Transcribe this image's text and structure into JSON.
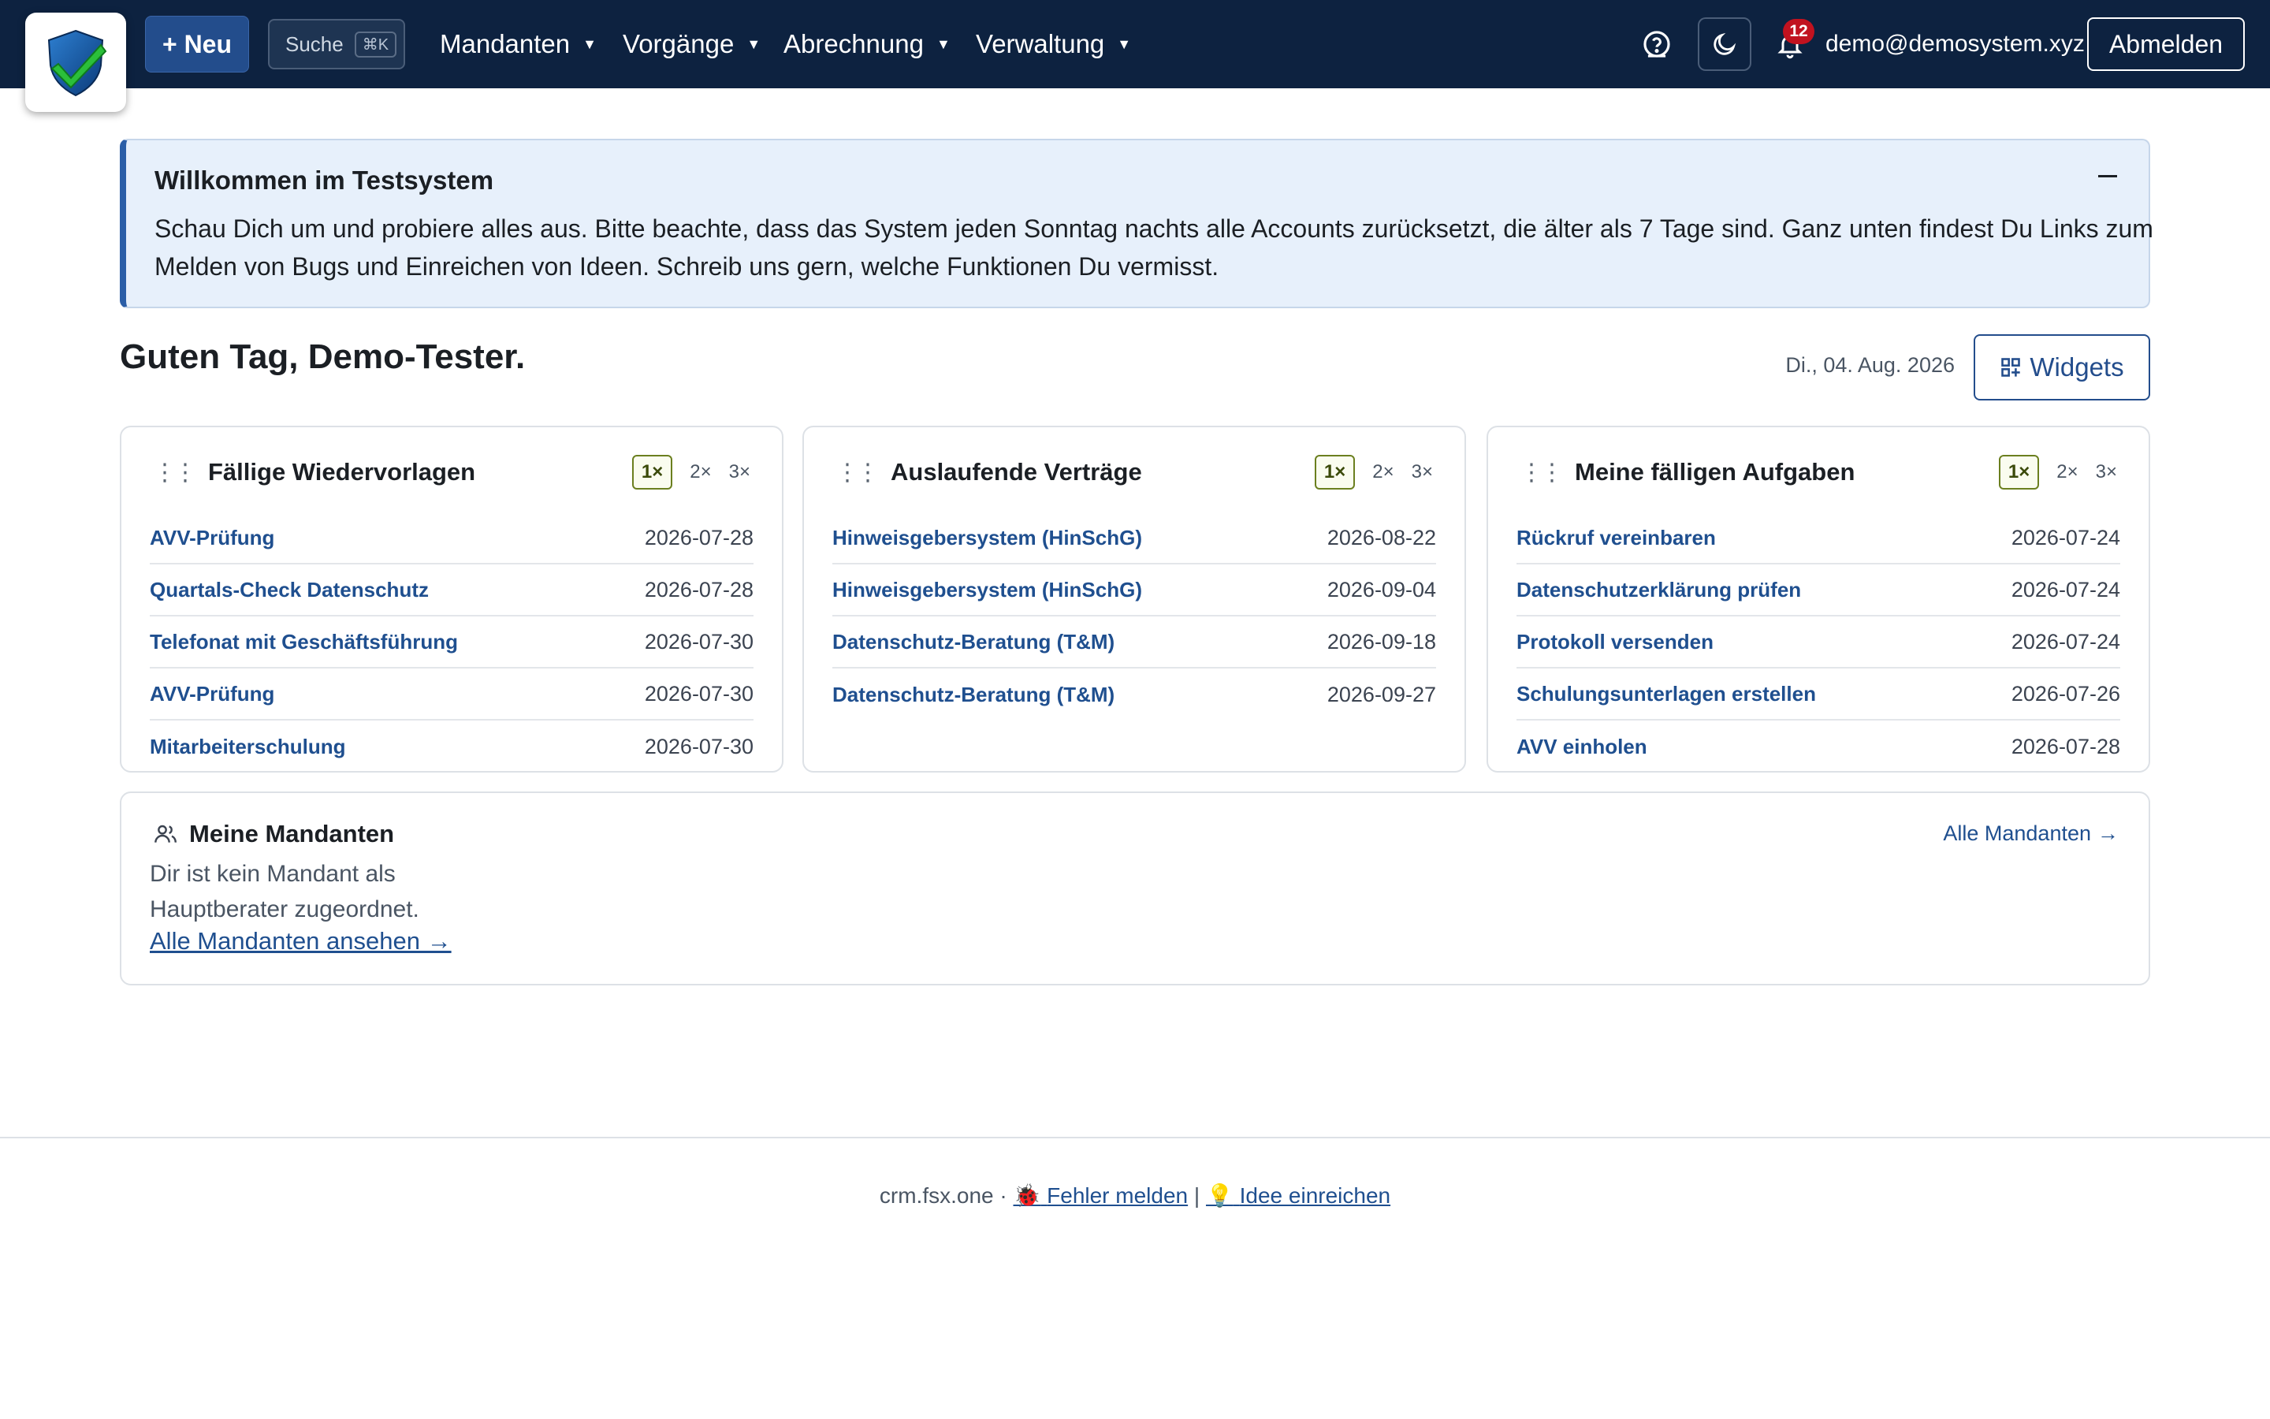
{
  "navbar": {
    "new_label": "+ Neu",
    "search_label": "Suche",
    "search_kbd": "⌘K",
    "menus": [
      "Mandanten",
      "Vorgänge",
      "Abrechnung",
      "Verwaltung"
    ],
    "notification_count": "12",
    "user_email": "demo@demosystem.xyz",
    "logout_label": "Abmelden",
    "icons": [
      "logo-shield",
      "help-icon",
      "moon-icon",
      "bell-icon"
    ]
  },
  "alert": {
    "title": "Willkommen im Testsystem",
    "text": "Schau Dich um und probiere alles aus. Bitte beachte, dass das System jeden Sonntag nachts alle Accounts zurücksetzt, die älter als 7 Tage sind. Ganz unten findest Du Links zum Melden von Bugs und Einreichen von Ideen. Schreib uns gern, welche Funktionen Du vermisst."
  },
  "greeting": "Guten Tag, Demo-Tester.",
  "date": "Di., 04. Aug. 2026",
  "widgets_label": "Widgets",
  "size_options": [
    "1×",
    "2×",
    "3×"
  ],
  "cards": [
    {
      "title": "Fällige Wiedervorlagen",
      "items": [
        {
          "label": "AVV-Prüfung",
          "date": "2026-07-28"
        },
        {
          "label": "Quartals-Check Datenschutz",
          "date": "2026-07-28"
        },
        {
          "label": "Telefonat mit Geschäftsführung",
          "date": "2026-07-30"
        },
        {
          "label": "AVV-Prüfung",
          "date": "2026-07-30"
        },
        {
          "label": "Mitarbeiterschulung",
          "date": "2026-07-30"
        }
      ]
    },
    {
      "title": "Auslaufende Verträge",
      "items": [
        {
          "label": "Hinweisgebersystem (HinSchG)",
          "date": "2026-08-22"
        },
        {
          "label": "Hinweisgebersystem (HinSchG)",
          "date": "2026-09-04"
        },
        {
          "label": "Datenschutz-Beratung (T&M)",
          "date": "2026-09-18"
        },
        {
          "label": "Datenschutz-Beratung (T&M)",
          "date": "2026-09-27"
        }
      ]
    },
    {
      "title": "Meine fälligen Aufgaben",
      "items": [
        {
          "label": "Rückruf vereinbaren",
          "date": "2026-07-24"
        },
        {
          "label": "Datenschutzerklärung prüfen",
          "date": "2026-07-24"
        },
        {
          "label": "Protokoll versenden",
          "date": "2026-07-24"
        },
        {
          "label": "Schulungsunterlagen erstellen",
          "date": "2026-07-26"
        },
        {
          "label": "AVV einholen",
          "date": "2026-07-28"
        }
      ]
    }
  ],
  "mandanten": {
    "title": "Meine Mandanten",
    "all_label": "Alle Mandanten",
    "text": "Dir ist kein Mandant als Hauptberater zugeordnet.",
    "link": "Alle Mandanten ansehen →"
  },
  "footer": {
    "domain": "crm.fsx.one ·",
    "bug_label": "Fehler melden",
    "separator": "|",
    "idea_label": "Idee einreichen"
  }
}
